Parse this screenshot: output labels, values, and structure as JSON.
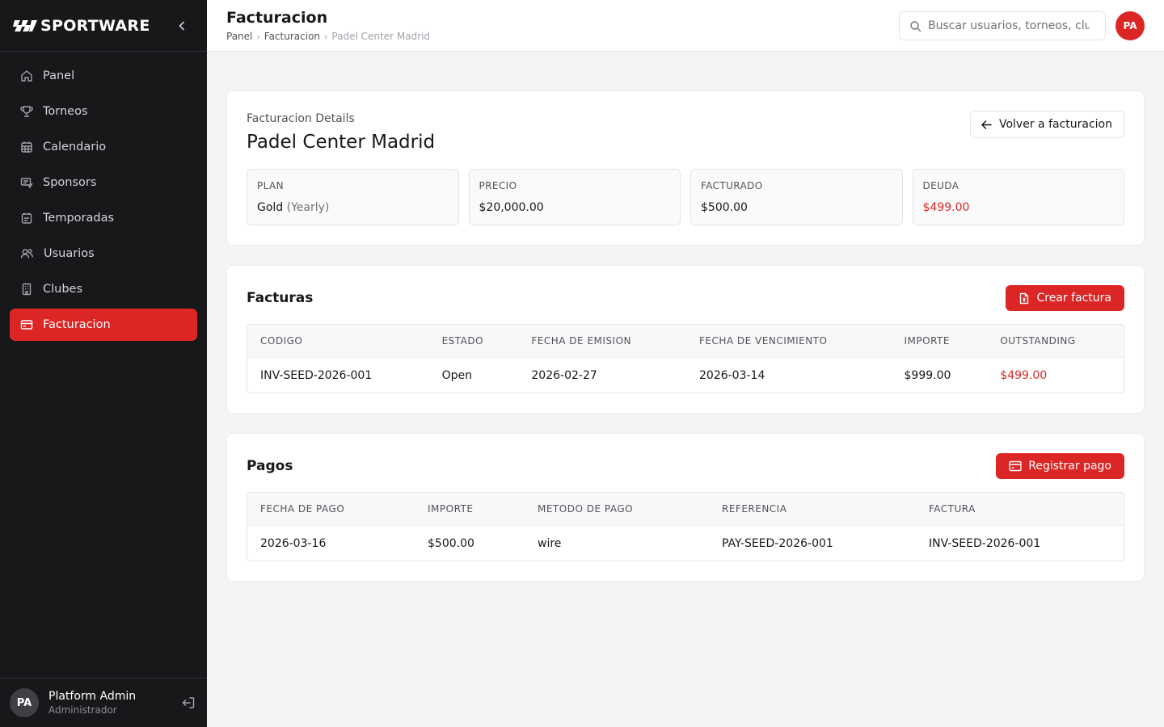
{
  "brand": {
    "name": "SPORTWARE"
  },
  "sidebar": {
    "items": [
      {
        "label": "Panel",
        "icon": "home-icon"
      },
      {
        "label": "Torneos",
        "icon": "trophy-icon"
      },
      {
        "label": "Calendario",
        "icon": "calendar-icon"
      },
      {
        "label": "Sponsors",
        "icon": "sponsor-icon"
      },
      {
        "label": "Temporadas",
        "icon": "calendar-list-icon"
      },
      {
        "label": "Usuarios",
        "icon": "users-icon"
      },
      {
        "label": "Clubes",
        "icon": "building-icon"
      },
      {
        "label": "Facturacion",
        "icon": "wallet-icon",
        "active": true
      }
    ],
    "user": {
      "initials": "PA",
      "name": "Platform Admin",
      "role": "Administrador"
    }
  },
  "header": {
    "title": "Facturacion",
    "breadcrumb": [
      "Panel",
      "Facturacion",
      "Padel Center Madrid"
    ],
    "search_placeholder": "Buscar usuarios, torneos, clubes...",
    "avatar_initials": "PA"
  },
  "details": {
    "label": "Facturacion Details",
    "title": "Padel Center Madrid",
    "back_label": "Volver a facturacion",
    "plan": {
      "label": "PLAN",
      "value": "Gold",
      "period": "(Yearly)"
    },
    "price": {
      "label": "PRECIO",
      "value": "$20,000.00"
    },
    "billed": {
      "label": "FACTURADO",
      "value": "$500.00"
    },
    "debt": {
      "label": "DEUDA",
      "value": "$499.00"
    }
  },
  "invoices": {
    "title": "Facturas",
    "create_label": "Crear factura",
    "columns": [
      "CODIGO",
      "ESTADO",
      "FECHA DE EMISION",
      "FECHA DE VENCIMIENTO",
      "IMPORTE",
      "OUTSTANDING"
    ],
    "rows": [
      [
        "INV-SEED-2026-001",
        "Open",
        "2026-02-27",
        "2026-03-14",
        "$999.00",
        "$499.00"
      ]
    ]
  },
  "payments": {
    "title": "Pagos",
    "register_label": "Registrar pago",
    "columns": [
      "FECHA DE PAGO",
      "IMPORTE",
      "METODO DE PAGO",
      "REFERENCIA",
      "FACTURA"
    ],
    "rows": [
      [
        "2026-03-16",
        "$500.00",
        "wire",
        "PAY-SEED-2026-001",
        "INV-SEED-2026-001"
      ]
    ]
  },
  "colors": {
    "accent": "#dc2626",
    "sidebar_bg": "#18181b",
    "page_bg": "#f4f4f5"
  }
}
